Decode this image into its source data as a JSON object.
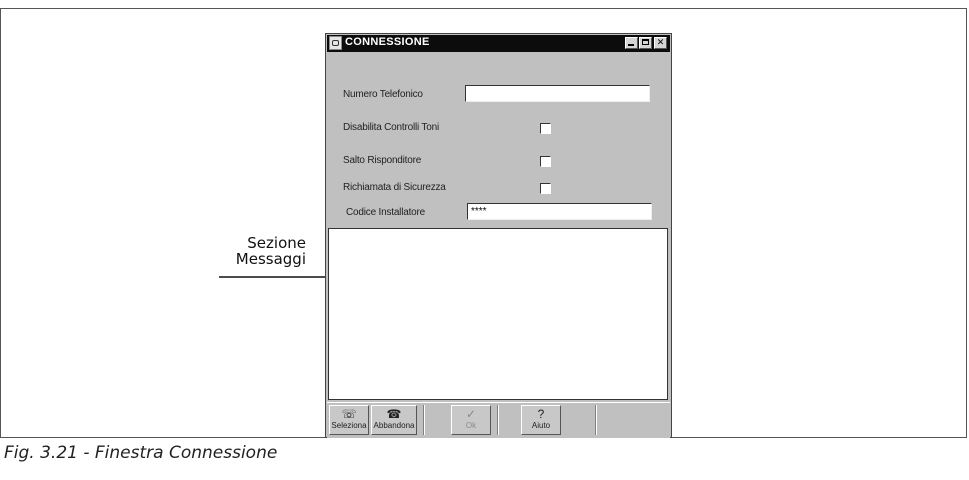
{
  "window": {
    "title": "CONNESSIONE",
    "icons": {
      "app": "app-icon",
      "minimize": "minimize-icon",
      "maximize": "maximize-icon",
      "close": "close-icon"
    },
    "close_glyph": "✕"
  },
  "form": {
    "phone_label": "Numero Telefonico",
    "phone_value": "",
    "disable_tones_label": "Disabilita Controlli Toni",
    "disable_tones_checked": false,
    "skip_answering_label": "Salto Risponditore",
    "skip_answering_checked": false,
    "callback_label": "Richiamata di Sicurezza",
    "callback_checked": false,
    "installer_code_label": "Codice Installatore",
    "installer_code_value": "****"
  },
  "messages_section": {
    "callout_line1": "Sezione",
    "callout_line2": "Messaggi"
  },
  "toolbar": {
    "select": {
      "label": "Seleziona",
      "icon": "dial-phone-icon",
      "glyph": "☏"
    },
    "hangup": {
      "label": "Abbandona",
      "icon": "hangup-phone-icon",
      "glyph": "☎"
    },
    "ok": {
      "label": "Ok",
      "icon": "checkmark-icon",
      "glyph": "✓"
    },
    "help": {
      "label": "Aiuto",
      "icon": "help-icon",
      "glyph": "?"
    }
  },
  "caption": "Fig. 3.21 - Finestra Connessione"
}
